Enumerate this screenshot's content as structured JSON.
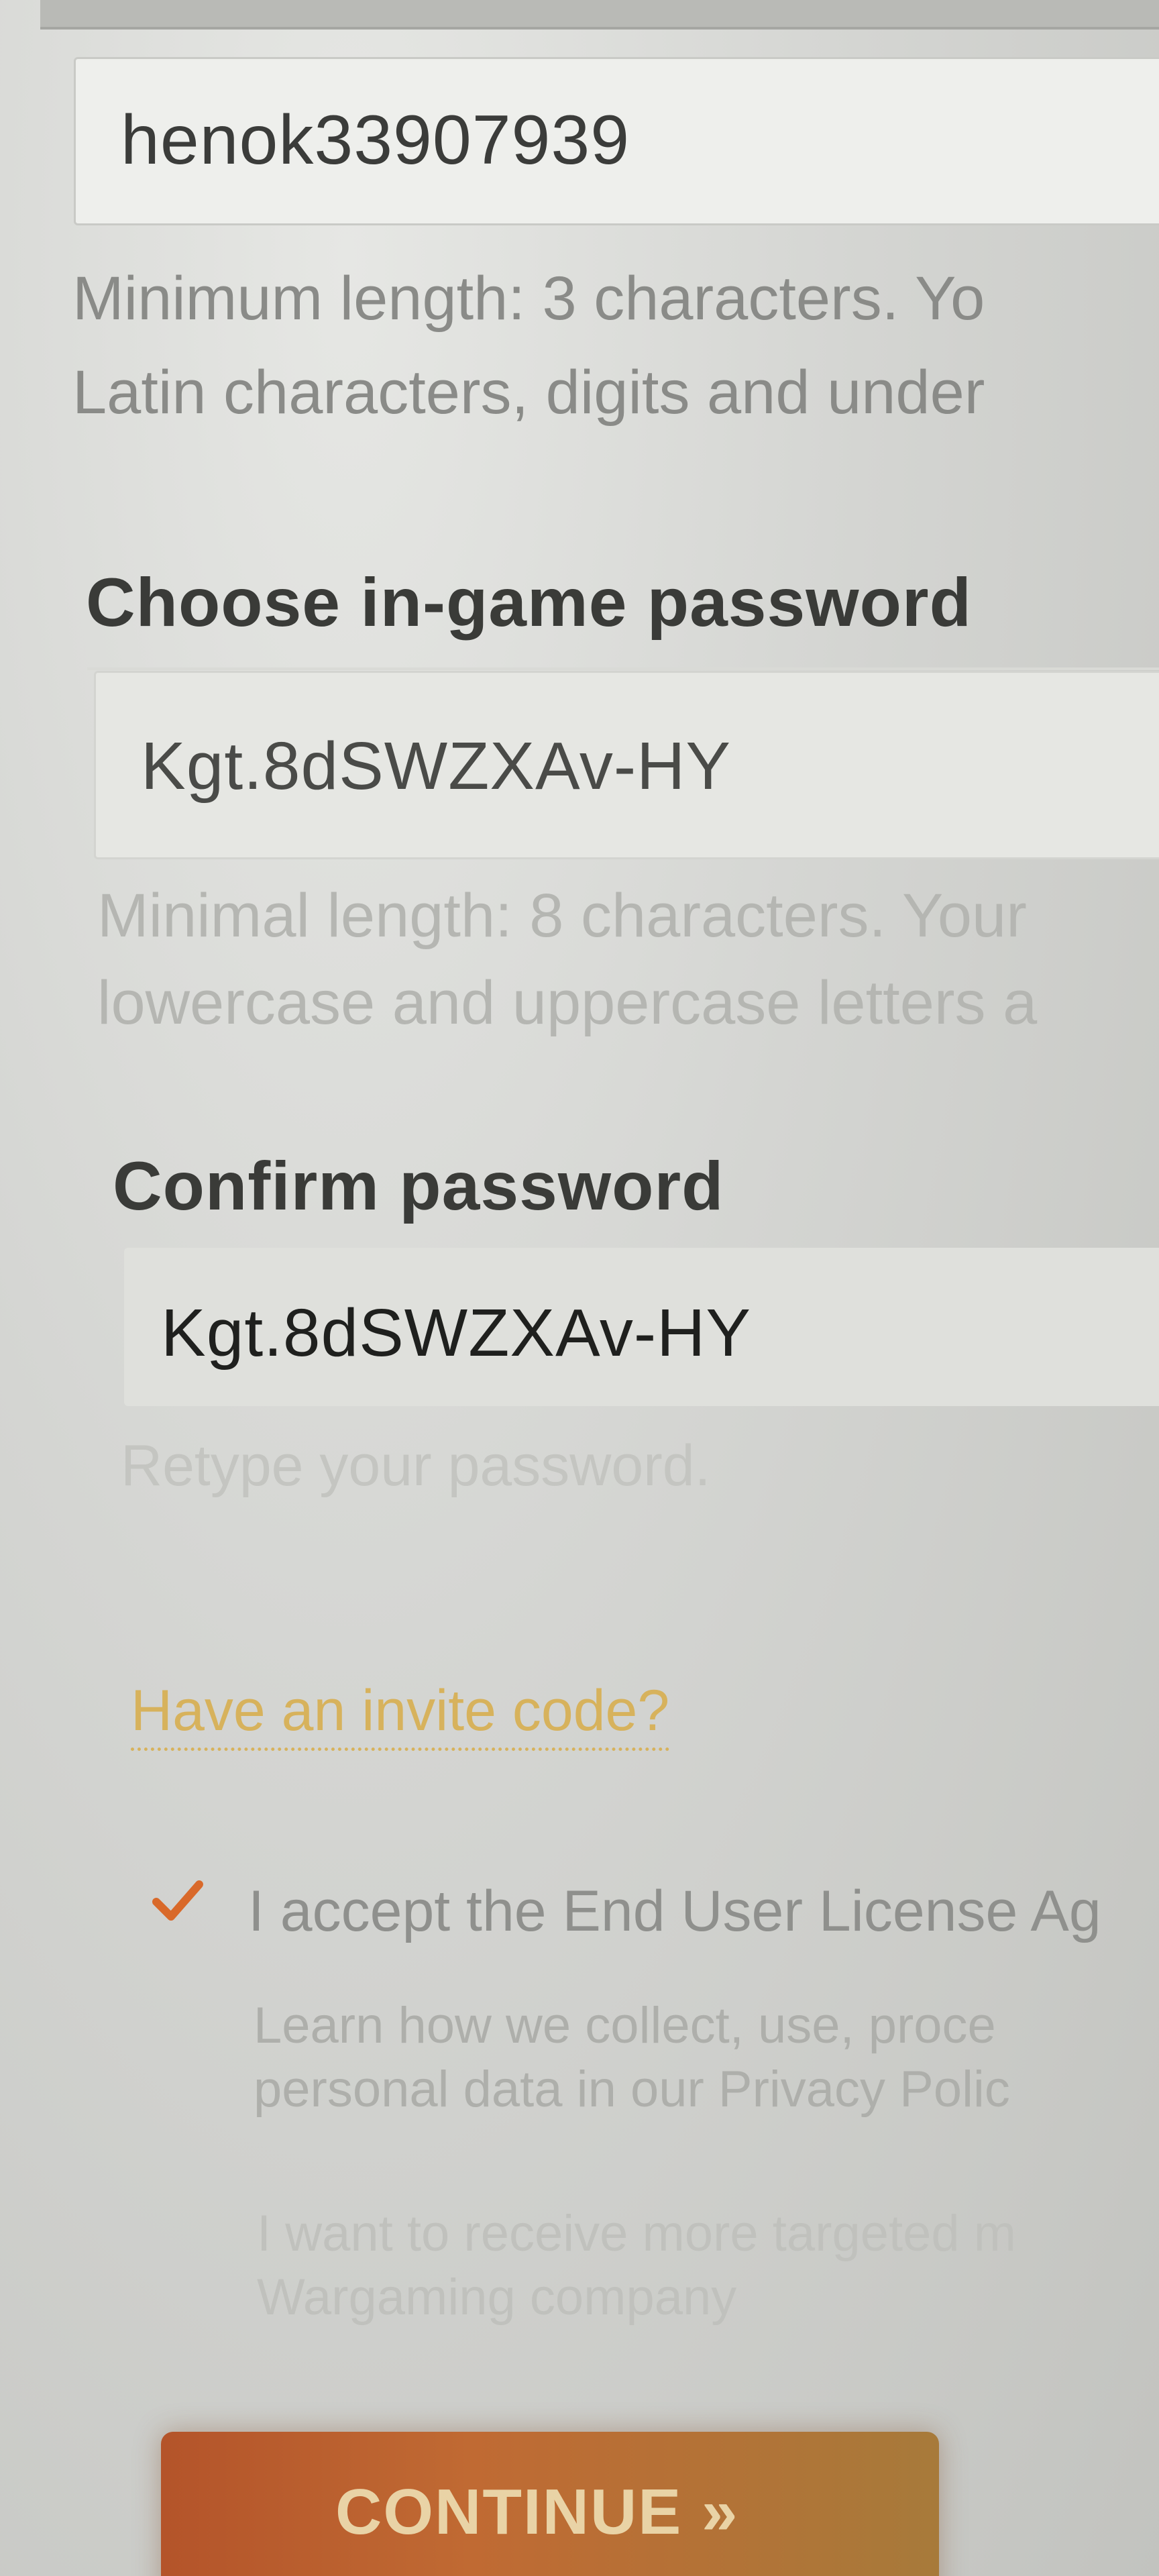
{
  "username": {
    "value": "henok33907939",
    "hint_line1": "Minimum length: 3 characters. Yo",
    "hint_line2": "Latin characters, digits and under"
  },
  "password": {
    "label": "Choose in-game password",
    "value": "Kgt.8dSWZXAv-HY",
    "hint_line1": "Minimal length: 8 characters. Your",
    "hint_line2": "lowercase and uppercase letters a"
  },
  "confirm": {
    "label": "Confirm password",
    "value": "Kgt.8dSWZXAv-HY",
    "hint": "Retype your password."
  },
  "invite_link": "Have an invite code?",
  "eula": {
    "checked": true,
    "label": "I accept the End User License Ag",
    "privacy_line1": "Learn how we collect, use, proce",
    "privacy_line2": "personal data in our Privacy Polic"
  },
  "marketing": {
    "line1": "I want to receive more targeted m",
    "line2": "Wargaming company"
  },
  "continue_button": "CONTINUE »",
  "colors": {
    "link": "#d7b25c",
    "checkmark": "#d9692a",
    "button": "#b4542a"
  }
}
